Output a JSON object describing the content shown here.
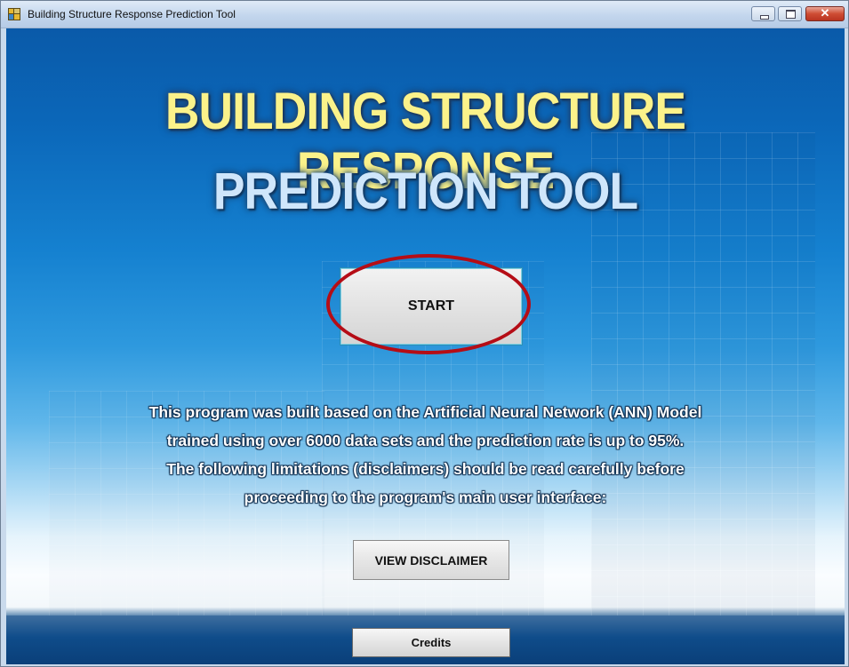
{
  "window": {
    "title": "Building Structure Response Prediction Tool"
  },
  "main": {
    "title_line1": "BUILDING STRUCTURE RESPONSE",
    "title_line2": "PREDICTION TOOL",
    "start_label": "START",
    "description": [
      "This program was built based on the Artificial Neural Network (ANN) Model",
      "trained using over 6000 data sets and the prediction rate is up to 95%.",
      "The following limitations (disclaimers) should be read carefully before",
      "proceeding to the program's main user interface:"
    ],
    "disclaimer_label": "VIEW DISCLAIMER",
    "credits_label": "Credits"
  },
  "icons": {
    "app": "app-icon",
    "minimize": "minimize-icon",
    "maximize": "maximize-icon",
    "close": "close-icon"
  },
  "colors": {
    "title_yellow": "#fbf28a",
    "title_blue": "#cfe6fb",
    "highlight_red": "#b50d16",
    "background_blue": "#0b67b9"
  }
}
